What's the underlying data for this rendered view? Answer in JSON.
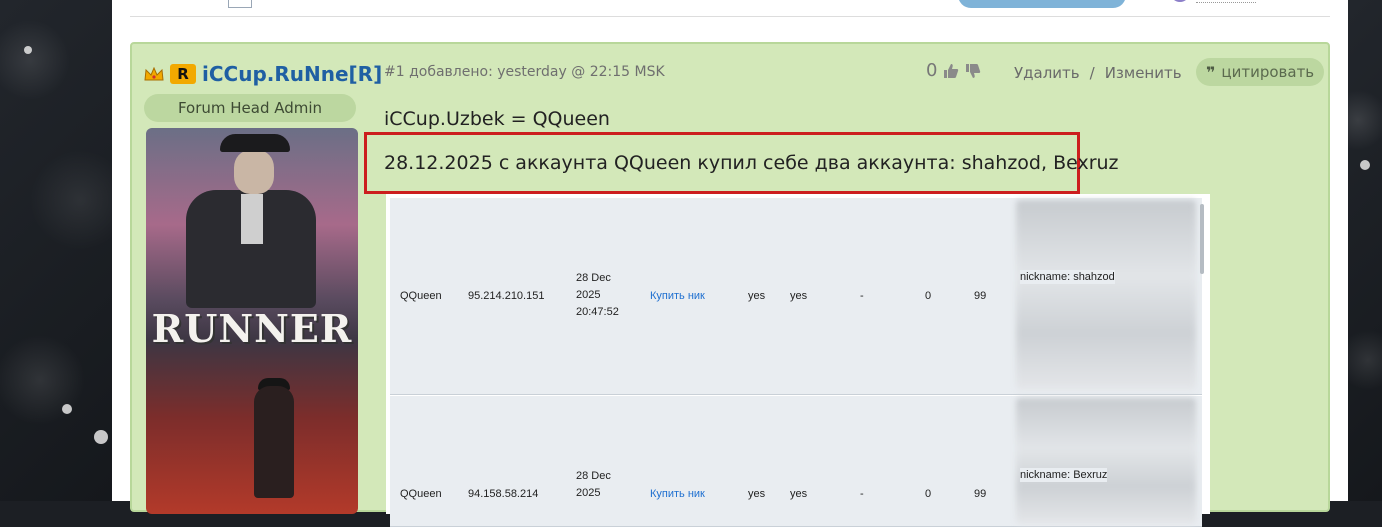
{
  "user": {
    "name": "iCCup.RuNne[R]",
    "role": "Forum Head Admin",
    "avatar_text": "RUNNER"
  },
  "post": {
    "meta": "#1 добавлено: yesterday @ 22:15 MSK",
    "votes": "0",
    "delete_label": "Удалить",
    "separator": "/",
    "edit_label": "Изменить",
    "quote_label": "цитировать",
    "line1": "iCCup.Uzbek = QQueen",
    "line2": "28.12.2025 с аккаунта QQueen купил себе два аккаунта: shahzod, Bexruz"
  },
  "screenshot_rows": [
    {
      "account": "QQueen",
      "ip": "95.214.210.151",
      "date_line1": "28 Dec",
      "date_line2": "2025",
      "date_line3": "20:47:52",
      "action": "Купить ник",
      "flag1": "yes",
      "flag2": "yes",
      "dash": "-",
      "num1": "0",
      "num2": "99",
      "nickname": "nickname: shahzod"
    },
    {
      "account": "QQueen",
      "ip": "94.158.58.214",
      "date_line1": "28 Dec",
      "date_line2": "2025",
      "date_line3": "",
      "action": "Купить ник",
      "flag1": "yes",
      "flag2": "yes",
      "dash": "-",
      "num1": "0",
      "num2": "99",
      "nickname": "nickname: Bexruz"
    }
  ],
  "colors": {
    "post_bg": "#d3e8b9",
    "username": "#1f5fa3",
    "highlight": "#cc1e1e",
    "link": "#1e6fd0"
  },
  "icons": [
    "crown-icon",
    "rank-icon",
    "thumbs-up-icon",
    "thumbs-down-icon",
    "quote-icon"
  ]
}
